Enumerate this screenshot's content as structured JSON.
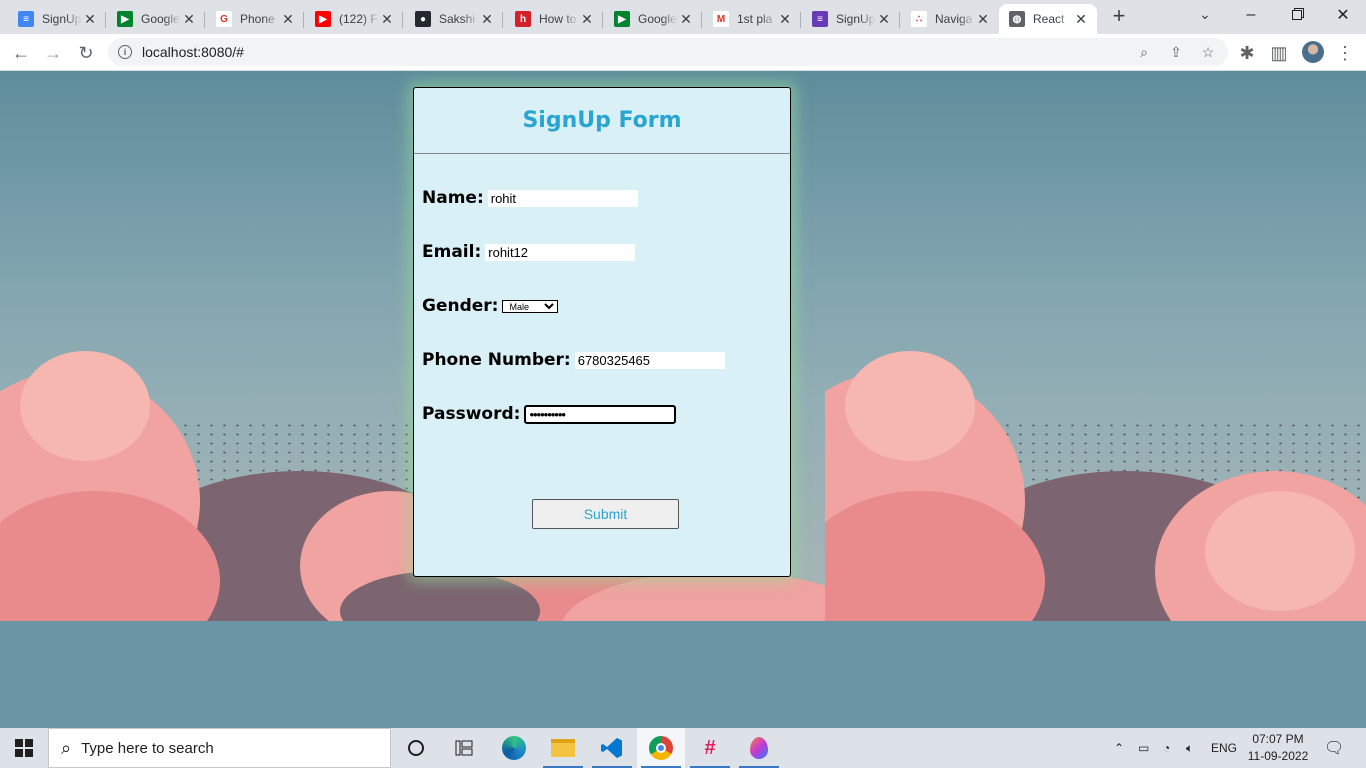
{
  "browser": {
    "tabs": [
      {
        "title": "SignUp",
        "favicon": "google-docs-icon",
        "color": "#4285f4",
        "glyph": "≡"
      },
      {
        "title": "Google",
        "favicon": "google-meet-icon",
        "color": "#00832d",
        "glyph": "▶"
      },
      {
        "title": "Phone",
        "favicon": "google-g-icon",
        "color": "#ffffff",
        "glyph": "G"
      },
      {
        "title": "(122) F",
        "favicon": "youtube-icon",
        "color": "#ff0000",
        "glyph": "▶"
      },
      {
        "title": "Sakshi",
        "favicon": "github-icon",
        "color": "#24292f",
        "glyph": "●"
      },
      {
        "title": "How to",
        "favicon": "hlo-icon",
        "color": "#d3212c",
        "glyph": "h"
      },
      {
        "title": "Google",
        "favicon": "google-meet-icon",
        "color": "#00832d",
        "glyph": "▶"
      },
      {
        "title": "1st pla",
        "favicon": "gmail-icon",
        "color": "#ffffff",
        "glyph": "M"
      },
      {
        "title": "SignUp",
        "favicon": "google-forms-icon",
        "color": "#673ab7",
        "glyph": "≡"
      },
      {
        "title": "Naviga",
        "favicon": "react-router-icon",
        "color": "#ffffff",
        "glyph": "∴"
      },
      {
        "title": "React",
        "favicon": "globe-icon",
        "color": "#5f6368",
        "glyph": "◍",
        "active": true
      }
    ],
    "url": "localhost:8080/#"
  },
  "form": {
    "title": "SignUp Form",
    "name_label": "Name:",
    "name_value": "rohit",
    "email_label": "Email:",
    "email_value": "rohit12",
    "gender_label": "Gender:",
    "gender_selected": "Male",
    "phone_label": "Phone Number:",
    "phone_value": "6780325465",
    "password_label": "Password:",
    "password_value": "••••••••••",
    "submit_label": "Submit"
  },
  "taskbar": {
    "search_placeholder": "Type here to search",
    "language": "ENG",
    "time": "07:07 PM",
    "date": "11-09-2022"
  }
}
